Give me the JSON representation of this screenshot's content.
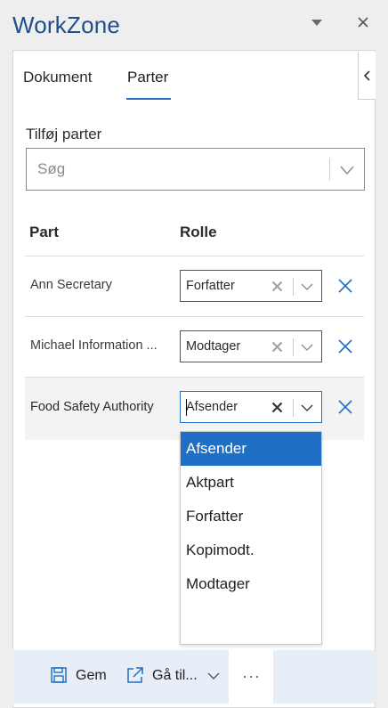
{
  "app": {
    "title": "WorkZone"
  },
  "tabs": [
    {
      "label": "Dokument",
      "active": false
    },
    {
      "label": "Parter",
      "active": true
    }
  ],
  "add_parties": {
    "label": "Tilføj parter",
    "search_placeholder": "Søg"
  },
  "table": {
    "headers": {
      "part": "Part",
      "rolle": "Rolle"
    },
    "rows": [
      {
        "party": "Ann Secretary",
        "role": "Forfatter"
      },
      {
        "party": "Michael Information ...",
        "role": "Modtager"
      },
      {
        "party": "Food Safety Authority",
        "role": "Afsender"
      }
    ]
  },
  "role_dropdown": {
    "options": [
      "Afsender",
      "Aktpart",
      "Forfatter",
      "Kopimodt.",
      "Modtager"
    ],
    "selected": "Afsender"
  },
  "footer": {
    "save_label": "Gem",
    "goto_label": "Gå til...",
    "more_label": "···"
  },
  "colors": {
    "accent": "#1f6fc5",
    "title": "#1f4e8c",
    "footer_bg": "#e8eef8"
  }
}
